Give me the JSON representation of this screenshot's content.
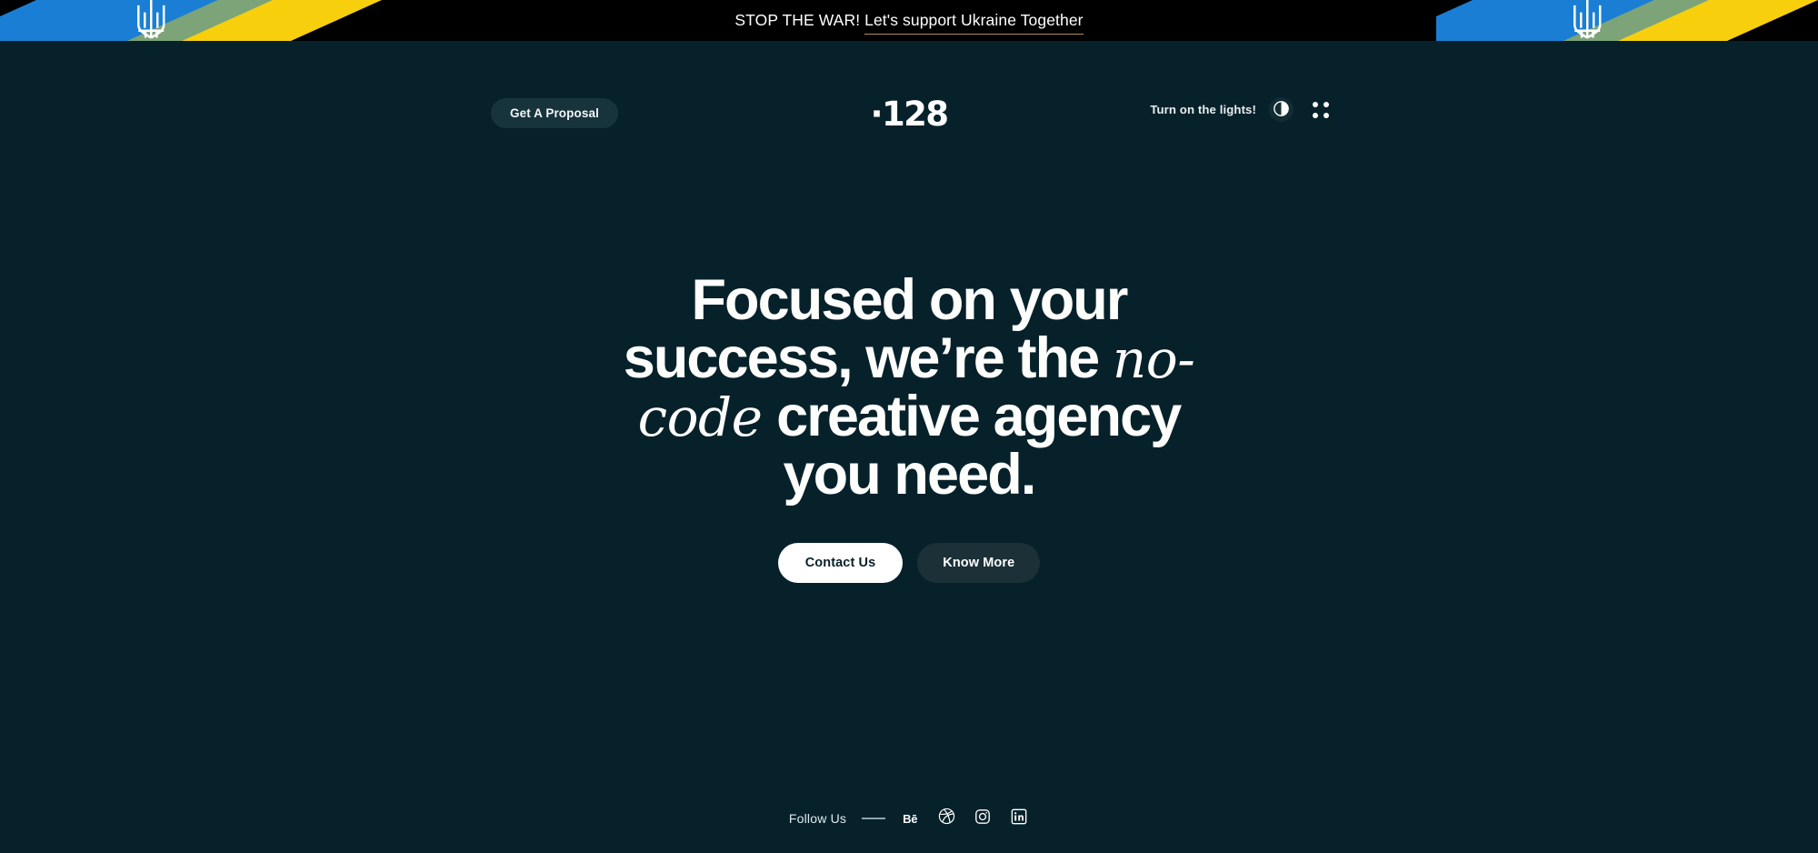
{
  "banner": {
    "prefix": "STOP THE WAR!",
    "link_text": "Let's support Ukraine Together",
    "background_color": "#000000",
    "underline_color": "#b08d5a",
    "flag_blue": "#1a7fd4",
    "flag_yellow": "#f7cf0d",
    "emblem_name": "ukraine-trident-emblem"
  },
  "header": {
    "proposal_button": "Get A Proposal",
    "logo": "·128",
    "lights_label": "Turn on the lights!",
    "theme_toggle_icon": "contrast-half-circle-icon",
    "menu_icon": "grid-dots-menu-icon"
  },
  "hero": {
    "headline_part1": "Focused on your success, we’re the ",
    "headline_script1": "no-",
    "headline_script2": "code",
    "headline_part2": " creative agency you need.",
    "primary_cta": "Contact Us",
    "secondary_cta": "Know More"
  },
  "footer": {
    "follow_label": "Follow Us",
    "socials": [
      {
        "name": "behance",
        "label": "Bē"
      },
      {
        "name": "dribbble",
        "label": "Dribbble"
      },
      {
        "name": "instagram",
        "label": "Instagram"
      },
      {
        "name": "linkedin",
        "label": "LinkedIn"
      }
    ]
  },
  "colors": {
    "background": "#07212a",
    "banner_bg": "#000000",
    "text_primary": "#ffffff",
    "button_dark": "#1b3037",
    "button_light": "#ffffff"
  }
}
